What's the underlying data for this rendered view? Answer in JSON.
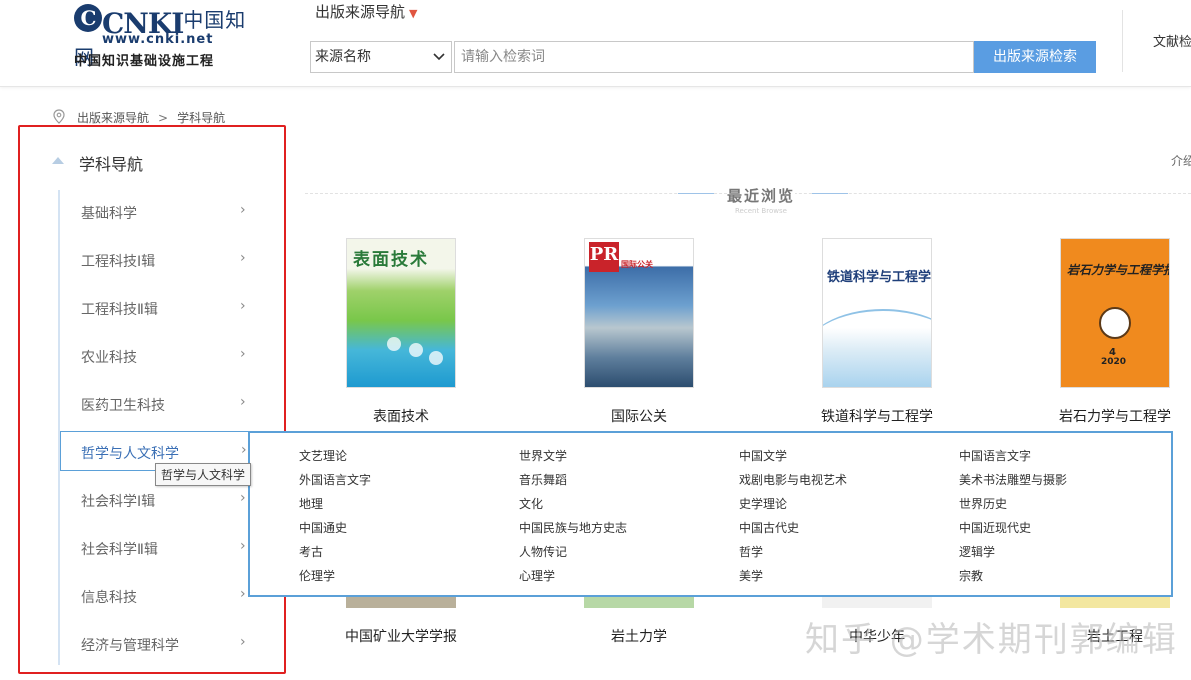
{
  "header": {
    "logo_letters": "CNKI",
    "logo_chinese": "中国知网",
    "logo_url": "www.cnki.net",
    "logo_subtitle": "中国知识基础设施工程",
    "nav_title": "出版来源导航",
    "source_select": "来源名称",
    "search_placeholder": "请输入检索词",
    "search_button": "出版来源检索",
    "doc_link": "文献检"
  },
  "breadcrumb": {
    "items": [
      "出版来源导航",
      "学科导航"
    ],
    "separator": ">"
  },
  "sidebar": {
    "title": "学科导航",
    "items": [
      {
        "label": "基础科学"
      },
      {
        "label": "工程科技Ⅰ辑"
      },
      {
        "label": "工程科技Ⅱ辑"
      },
      {
        "label": "农业科技"
      },
      {
        "label": "医药卫生科技"
      },
      {
        "label": "哲学与人文科学"
      },
      {
        "label": "社会科学Ⅰ辑"
      },
      {
        "label": "社会科学Ⅱ辑"
      },
      {
        "label": "信息科技"
      },
      {
        "label": "经济与管理科学"
      }
    ],
    "active_index": 5,
    "tooltip": "哲学与人文科学",
    "highlight_color": "#e02020"
  },
  "recent": {
    "title": "最近浏览",
    "subtitle": "Recent Browse",
    "intro_link": "介绍",
    "journals_row1": [
      {
        "name": "表面技术",
        "cover_title": "表面技术"
      },
      {
        "name": "国际公关",
        "cover_title": "PR",
        "cover_sub": "国际公关"
      },
      {
        "name": "铁道科学与工程学",
        "cover_title": "铁道科学与工程学报"
      },
      {
        "name": "岩石力学与工程学",
        "cover_title": "岩石力学与工程学报",
        "cover_issue": "4",
        "cover_year": "2020"
      }
    ],
    "journals_row2": [
      {
        "name": "中国矿业大学学报"
      },
      {
        "name": "岩土力学"
      },
      {
        "name": "中华少年"
      },
      {
        "name": "岩土工程"
      }
    ]
  },
  "subcategories": [
    [
      "文艺理论",
      "世界文学",
      "中国文学",
      "中国语言文字"
    ],
    [
      "外国语言文字",
      "音乐舞蹈",
      "戏剧电影与电视艺术",
      "美术书法雕塑与摄影"
    ],
    [
      "地理",
      "文化",
      "史学理论",
      "世界历史"
    ],
    [
      "中国通史",
      "中国民族与地方史志",
      "中国古代史",
      "中国近现代史"
    ],
    [
      "考古",
      "人物传记",
      "哲学",
      "逻辑学"
    ],
    [
      "伦理学",
      "心理学",
      "美学",
      "宗教"
    ]
  ],
  "watermark": "知乎 @学术期刊郭编辑",
  "colors": {
    "accent": "#5a9de2",
    "panel_border": "#5ba0d8",
    "red_box": "#e02020"
  }
}
